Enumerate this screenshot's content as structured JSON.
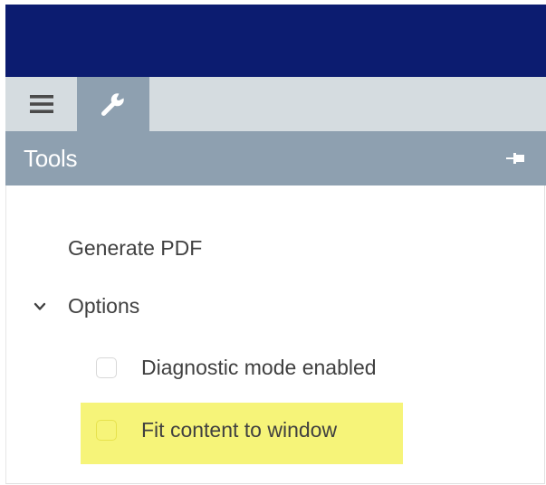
{
  "colors": {
    "top_bar": "#0c1c70",
    "tab_strip": "#d5dce0",
    "header": "#8ea0b0",
    "highlight": "#f6f479"
  },
  "tabs": [
    {
      "icon": "hamburger-menu-icon",
      "active": false
    },
    {
      "icon": "wrench-icon",
      "active": true
    }
  ],
  "tools_panel": {
    "title": "Tools",
    "pin_icon": "pin-icon",
    "items": {
      "generate_pdf": "Generate PDF",
      "options": {
        "label": "Options",
        "expanded": true,
        "checkboxes": [
          {
            "label": "Diagnostic mode enabled",
            "checked": false,
            "highlighted": false
          },
          {
            "label": "Fit content to window",
            "checked": false,
            "highlighted": true
          }
        ]
      }
    }
  }
}
